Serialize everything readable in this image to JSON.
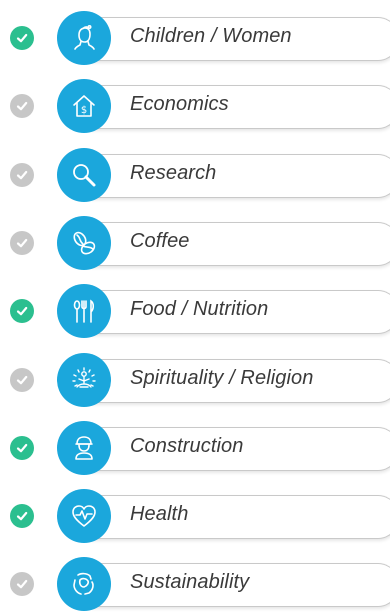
{
  "colors": {
    "accent": "#1ba7dc",
    "check_on": "#2bbf8f",
    "check_off": "#c7c7c7",
    "text": "#3a3a3a"
  },
  "categories": [
    {
      "label": "Children / Women",
      "checked": true,
      "icon": "child-face-icon"
    },
    {
      "label": "Economics",
      "checked": false,
      "icon": "house-dollar-icon"
    },
    {
      "label": "Research",
      "checked": false,
      "icon": "magnifier-icon"
    },
    {
      "label": "Coffee",
      "checked": false,
      "icon": "coffee-bean-icon"
    },
    {
      "label": "Food / Nutrition",
      "checked": true,
      "icon": "utensils-icon"
    },
    {
      "label": "Spirituality / Religion",
      "checked": false,
      "icon": "meditation-icon"
    },
    {
      "label": "Construction",
      "checked": true,
      "icon": "worker-helmet-icon"
    },
    {
      "label": "Health",
      "checked": true,
      "icon": "heart-pulse-icon"
    },
    {
      "label": "Sustainability",
      "checked": false,
      "icon": "recycle-globe-icon"
    }
  ]
}
